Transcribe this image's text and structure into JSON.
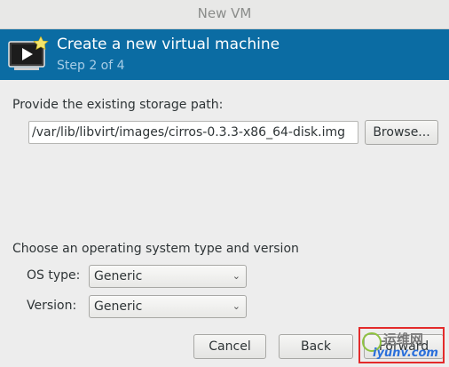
{
  "window": {
    "title": "New VM"
  },
  "header": {
    "title": "Create a new virtual machine",
    "step": "Step 2 of 4"
  },
  "storage": {
    "prompt": "Provide the existing storage path:",
    "path_value": "/var/lib/libvirt/images/cirros-0.3.3-x86_64-disk.img",
    "browse_label": "Browse..."
  },
  "os": {
    "prompt": "Choose an operating system type and version",
    "type_label": "OS type:",
    "type_value": "Generic",
    "version_label": "Version:",
    "version_value": "Generic"
  },
  "footer": {
    "cancel_label": "Cancel",
    "back_label": "Back",
    "forward_label": "Forward"
  },
  "watermark": {
    "line1": "运维网",
    "line2": "iyunv.com"
  },
  "colors": {
    "banner": "#0b6ca3",
    "watermark_border": "#e32b2b"
  }
}
